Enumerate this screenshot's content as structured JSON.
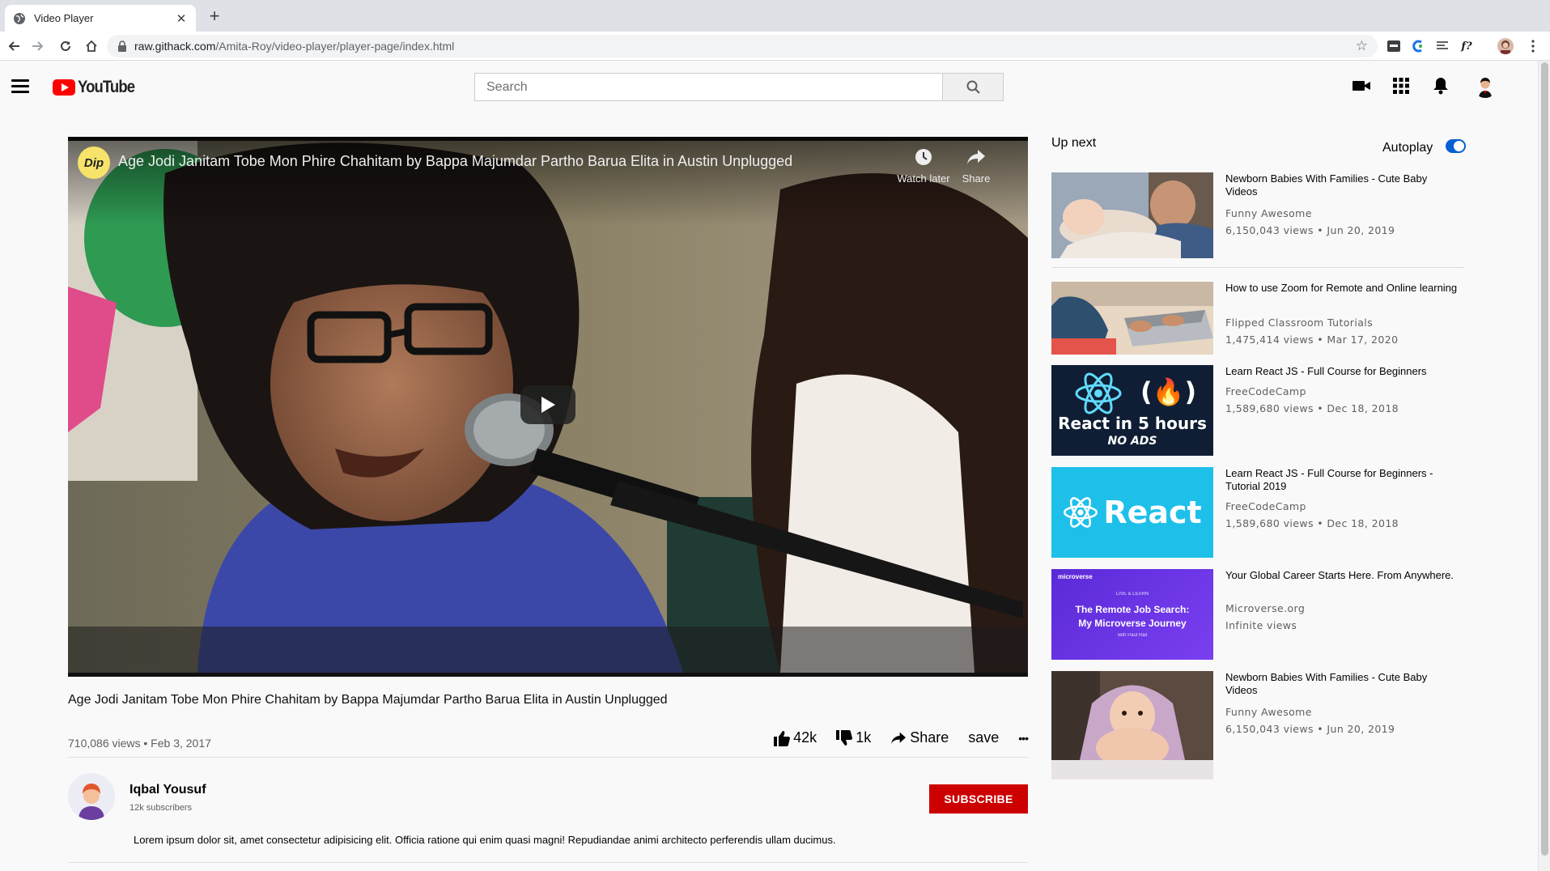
{
  "browser": {
    "tab_title": "Video Player",
    "tab_close": "✕",
    "new_tab": "+",
    "url_host": "raw.githack.com",
    "url_path": "/Amita-Roy/video-player/player-page/index.html",
    "ext_formula": "f?"
  },
  "header": {
    "logo_text": "YouTube",
    "search_placeholder": "Search"
  },
  "player": {
    "title": "Age Jodi Janitam Tobe Mon Phire Chahitam by Bappa Majumdar Partho Barua Elita in Austin Unplugged",
    "channel_icon_text": "Dip",
    "watch_later": "Watch later",
    "share": "Share"
  },
  "video": {
    "title": "Age Jodi Janitam Tobe Mon Phire Chahitam by Bappa Majumdar Partho Barua Elita in Austin Unplugged",
    "views_date": "710,086 views • Feb 3, 2017",
    "likes": "42k",
    "dislikes": "1k",
    "share": "Share",
    "save": "save",
    "more": "•••"
  },
  "owner": {
    "name": "Iqbal Yousuf",
    "subscribers": "12k subscribers",
    "subscribe_label": "SUBSCRIBE",
    "description": "Lorem ipsum dolor sit, amet consectetur adipisicing elit. Officia ratione qui enim quasi magni! Repudiandae animi architecto perferendis ullam ducimus."
  },
  "sidebar": {
    "up_next": "Up next",
    "autoplay": "Autoplay",
    "autoplay_on": true,
    "items": [
      {
        "title": "Newborn Babies With Families - Cute Baby Videos",
        "channel": "Funny Awesome",
        "meta": "6,150,043 views • Jun 20, 2019"
      },
      {
        "title": "How to use Zoom for Remote and Online learning",
        "channel": "Flipped Classroom Tutorials",
        "meta": "1,475,414 views • Mar 17, 2020"
      },
      {
        "title": "Learn React JS - Full Course for Beginners",
        "channel": "FreeCodeCamp",
        "meta": "1,589,680 views • Dec 18, 2018",
        "thumb_text": "React in 5 hours",
        "thumb_sub": "NO ADS",
        "thumb_code": "(🔥)"
      },
      {
        "title": "Learn React JS - Full Course for Beginners - Tutorial 2019",
        "channel": "FreeCodeCamp",
        "meta": "1,589,680 views • Dec 18, 2018",
        "thumb_text": "React"
      },
      {
        "title": "Your Global Career Starts Here. From Anywhere.",
        "channel": "Microverse.org",
        "meta": "Infinite views",
        "thumb_brand": "microverse",
        "thumb_kicker": "LIVE & LEARN",
        "thumb_line1": "The Remote Job Search:",
        "thumb_line2": "My Microverse Journey",
        "thumb_line3": "with Paul Rail"
      },
      {
        "title": "Newborn Babies With Families - Cute Baby Videos",
        "channel": "Funny Awesome",
        "meta": "6,150,043 views • Jun 20, 2019"
      }
    ]
  },
  "colors": {
    "brand_red": "#ff0000",
    "subscribe_red": "#cc0000",
    "toggle_blue": "#065fd4"
  }
}
